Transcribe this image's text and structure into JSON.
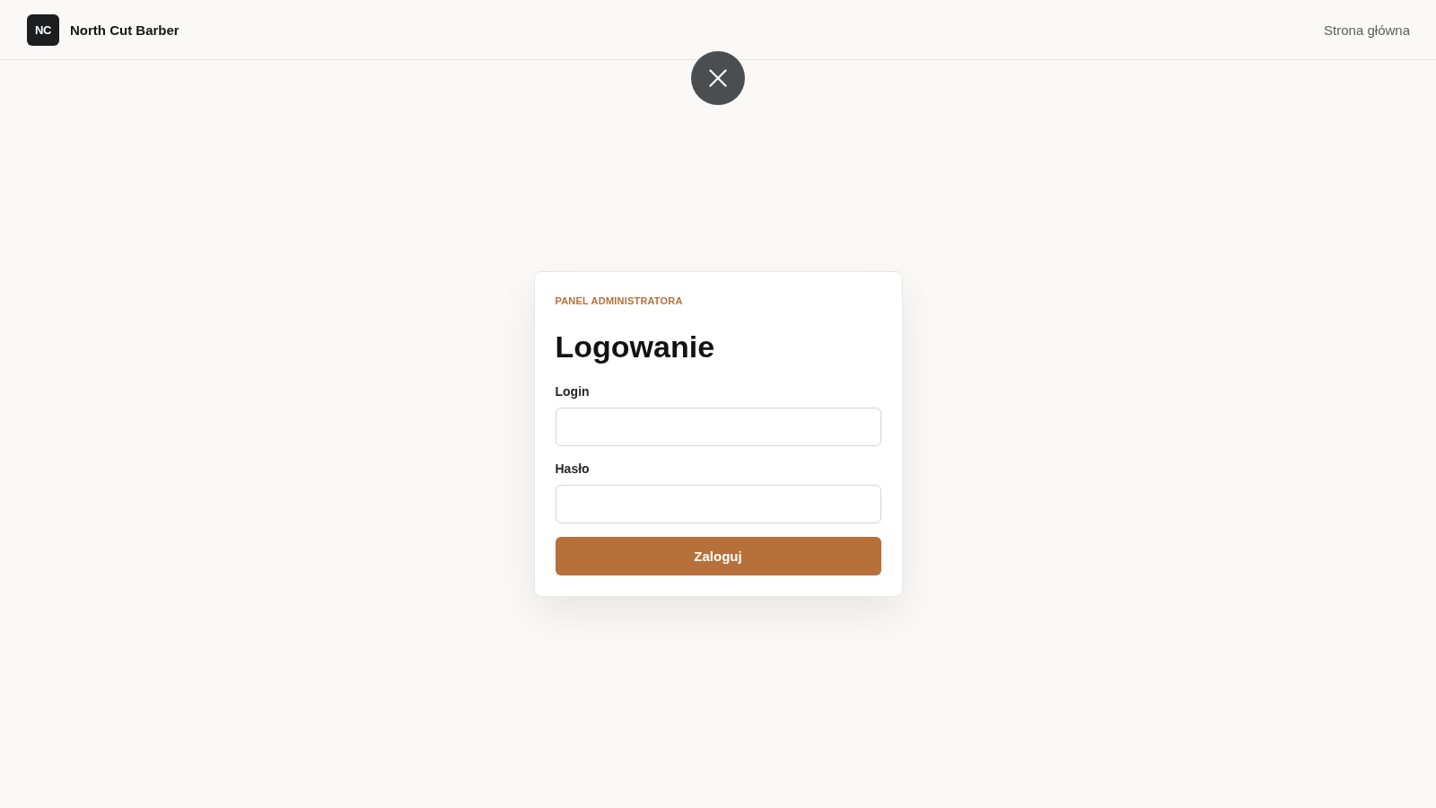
{
  "header": {
    "logo": "NC",
    "brand": "North Cut Barber",
    "nav": [
      {
        "label": "Strona główna"
      }
    ]
  },
  "login_card": {
    "eyebrow": "PANEL ADMINISTRATORA",
    "title": "Logowanie",
    "fields": [
      {
        "label": "Login"
      },
      {
        "label": "Hasło"
      }
    ],
    "submit": "Zaloguj"
  }
}
